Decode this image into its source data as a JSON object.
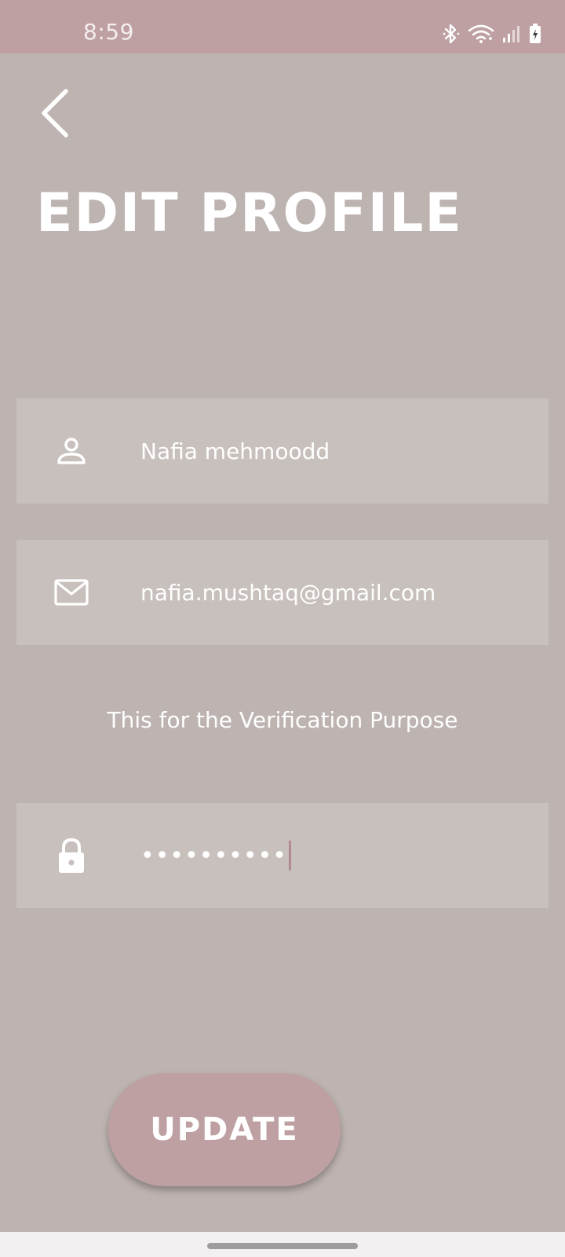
{
  "status_bar": {
    "time": "8:59",
    "icons": [
      "bluetooth-icon",
      "wifi-icon",
      "signal-icon",
      "battery-charging-icon"
    ],
    "background": "#bea0a2"
  },
  "header": {
    "back_icon": "chevron-left-icon",
    "title": "EDIT PROFILE"
  },
  "form": {
    "name": {
      "icon": "person-icon",
      "value": "Nafia mehmoodd"
    },
    "email": {
      "icon": "mail-icon",
      "value": "nafia.mushtaq@gmail.com"
    },
    "helper_text": "This for the Verification Purpose",
    "password": {
      "icon": "lock-icon",
      "value": "••••••••••"
    }
  },
  "actions": {
    "update_label": "UPDATE"
  },
  "colors": {
    "background": "#bdb3b0",
    "field_background": "#c8c0bc",
    "accent": "#bea0a2",
    "text": "#ffffff"
  }
}
